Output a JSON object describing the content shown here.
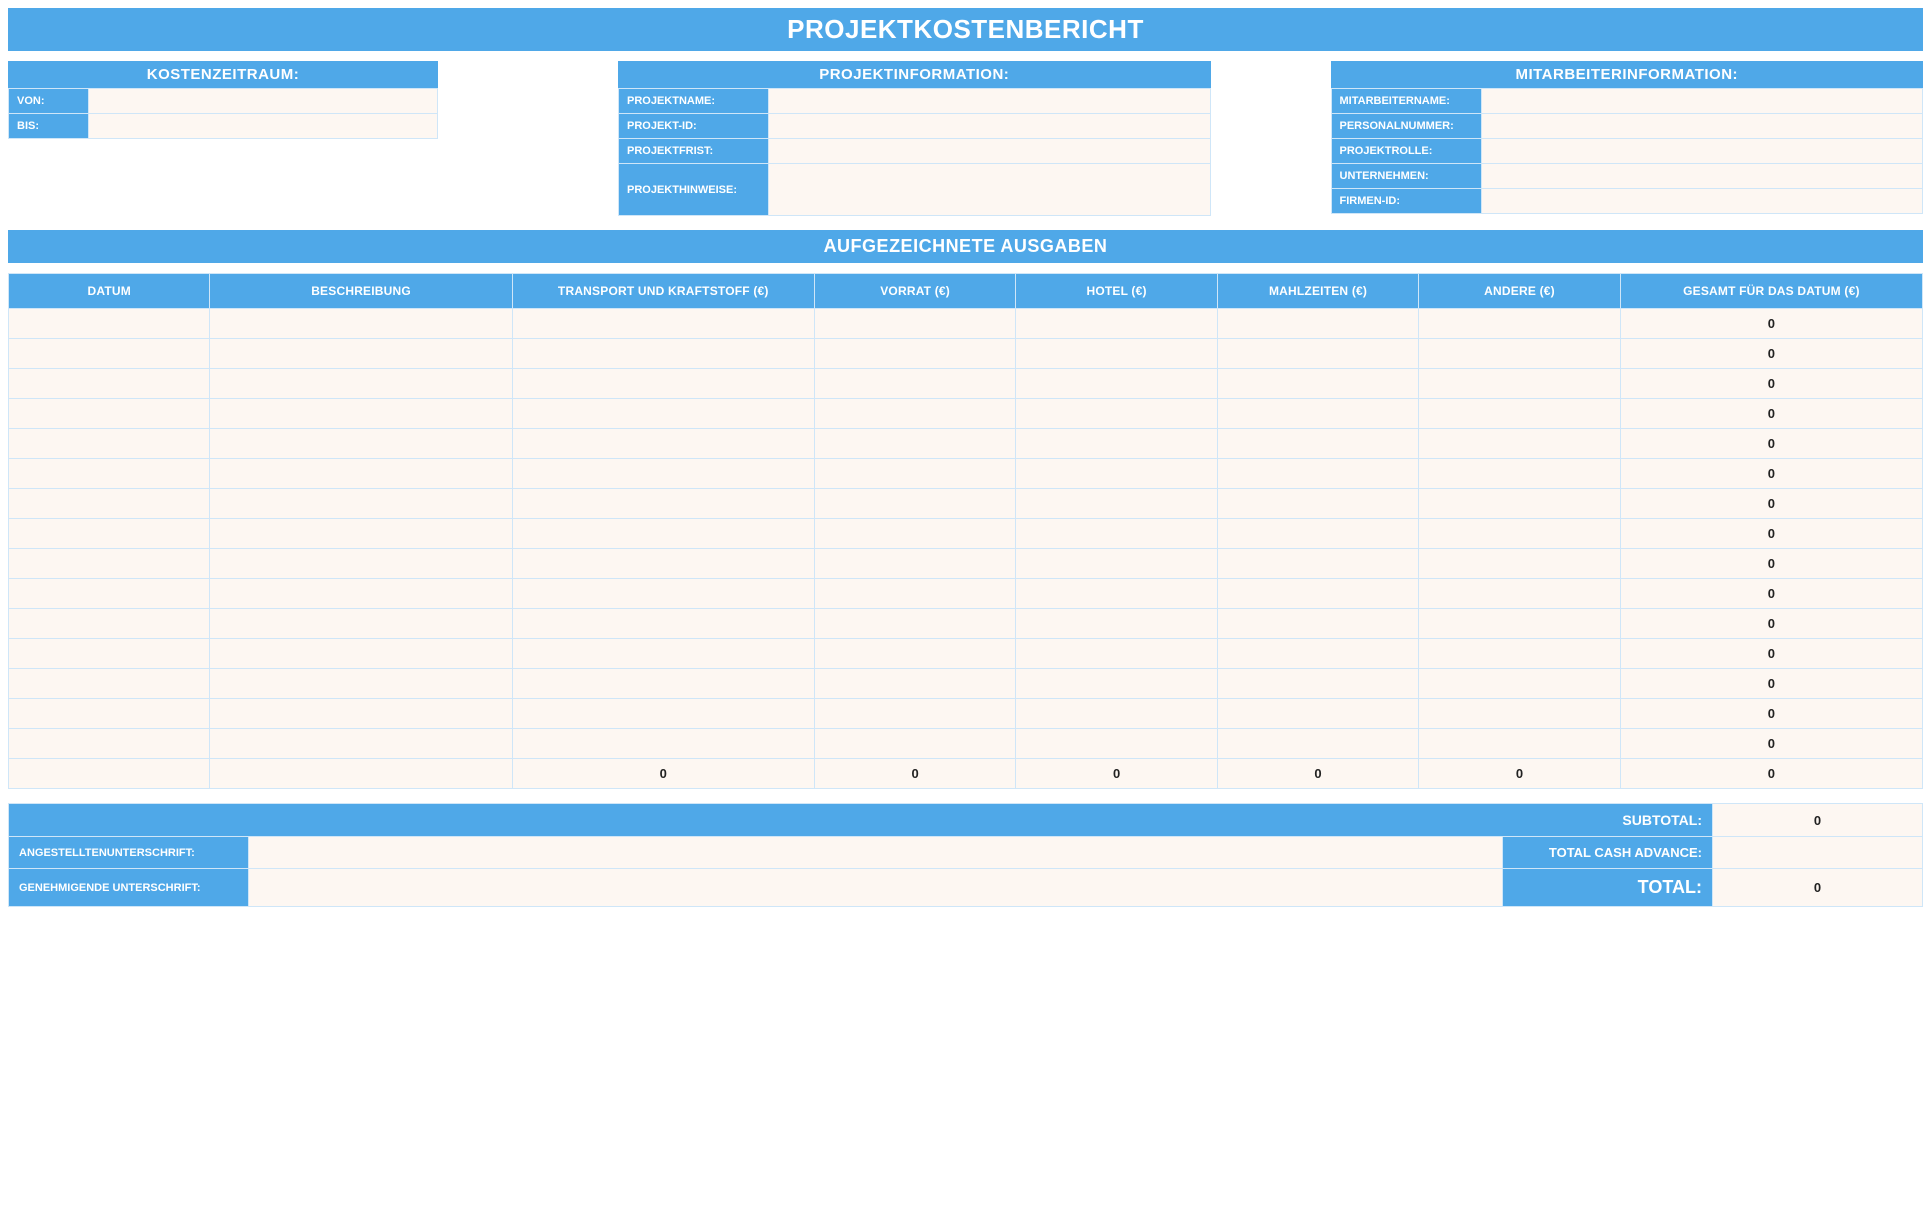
{
  "title": "PROJEKTKOSTENBERICHT",
  "cost_period": {
    "header": "KOSTENZEITRAUM:",
    "from_label": "VON:",
    "from_value": "",
    "to_label": "BIS:",
    "to_value": ""
  },
  "project_info": {
    "header": "PROJEKTINFORMATION:",
    "name_label": "PROJEKTNAME:",
    "name_value": "",
    "id_label": "PROJEKT-ID:",
    "id_value": "",
    "deadline_label": "PROJEKTFRIST:",
    "deadline_value": "",
    "notes_label": "PROJEKTHINWEISE:",
    "notes_value": ""
  },
  "employee_info": {
    "header": "MITARBEITERINFORMATION:",
    "name_label": "MITARBEITERNAME:",
    "name_value": "",
    "personnel_label": "PERSONALNUMMER:",
    "personnel_value": "",
    "role_label": "PROJEKTROLLE:",
    "role_value": "",
    "company_label": "UNTERNEHMEN:",
    "company_value": "",
    "company_id_label": "FIRMEN-ID:",
    "company_id_value": ""
  },
  "expenses": {
    "header": "AUFGEZEICHNETE AUSGABEN",
    "columns": [
      "DATUM",
      "BESCHREIBUNG",
      "TRANSPORT UND KRAFTSTOFF (€)",
      "VORRAT (€)",
      "HOTEL (€)",
      "MAHLZEITEN (€)",
      "ANDERE (€)",
      "GESAMT FÜR DAS DATUM (€)"
    ],
    "rows": [
      {
        "total": "0"
      },
      {
        "total": "0"
      },
      {
        "total": "0"
      },
      {
        "total": "0"
      },
      {
        "total": "0"
      },
      {
        "total": "0"
      },
      {
        "total": "0"
      },
      {
        "total": "0"
      },
      {
        "total": "0"
      },
      {
        "total": "0"
      },
      {
        "total": "0"
      },
      {
        "total": "0"
      },
      {
        "total": "0"
      },
      {
        "total": "0"
      },
      {
        "total": "0"
      }
    ],
    "col_totals": [
      "0",
      "0",
      "0",
      "0",
      "0",
      "0"
    ]
  },
  "footer": {
    "subtotal_label": "SUBTOTAL:",
    "subtotal_value": "0",
    "employee_sig_label": "ANGESTELLTENUNTERSCHRIFT:",
    "cash_advance_label": "TOTAL CASH ADVANCE:",
    "cash_advance_value": "",
    "approver_sig_label": "GENEHMIGENDE UNTERSCHRIFT:",
    "total_label": "TOTAL:",
    "total_value": "0"
  }
}
